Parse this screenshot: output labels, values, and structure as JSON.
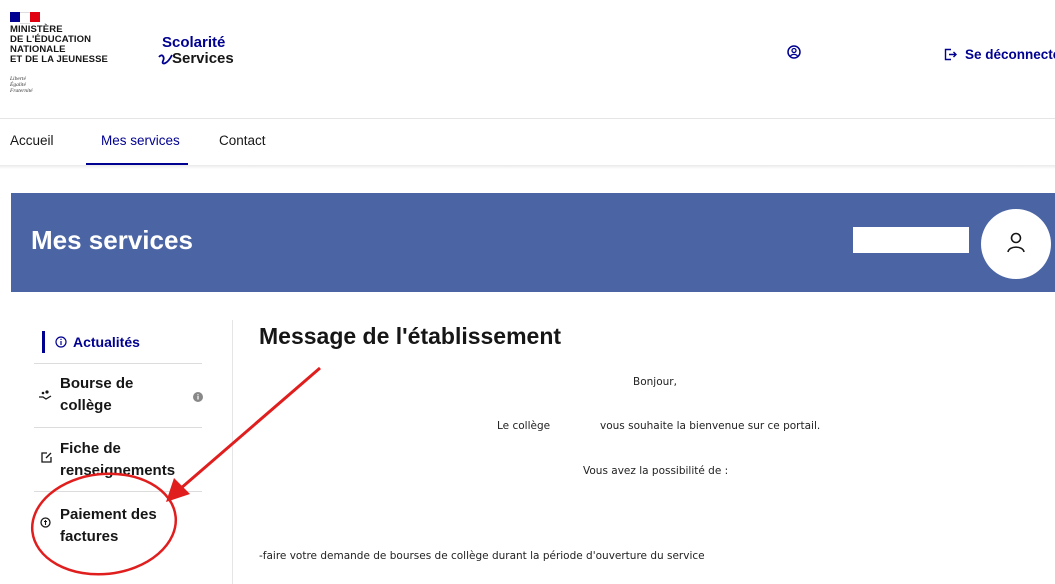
{
  "header": {
    "ministry_name": "MINISTÈRE\nDE L'ÉDUCATION\nNATIONALE\nET DE LA JEUNESSE",
    "motto": "Liberté\nÉgalité\nFraternité",
    "brand_top": "Scolarité",
    "brand_bottom": "Services",
    "logout_label": "Se déconnecter",
    "icons": [
      "account-icon",
      "logout-icon"
    ],
    "flag_colors": [
      "#000091",
      "#ffffff",
      "#e1000f"
    ]
  },
  "nav": {
    "items": [
      {
        "label": "Accueil",
        "active": false
      },
      {
        "label": "Mes services",
        "active": true
      },
      {
        "label": "Contact",
        "active": false
      }
    ]
  },
  "banner": {
    "title": "Mes services",
    "color": "#4a64a4"
  },
  "sidebar": {
    "items": [
      {
        "label": "Actualités",
        "icon": "info-icon",
        "active": true
      },
      {
        "label": "Bourse de collège",
        "icon": "hand-coins-icon",
        "badge_icon": "info-badge-icon"
      },
      {
        "label": "Fiche de renseignements",
        "icon": "edit-icon"
      },
      {
        "label": "Paiement des factures",
        "icon": "payment-icon"
      }
    ]
  },
  "main": {
    "title": "Message de l'établissement",
    "lines": [
      "Bonjour,",
      "Le collège",
      "vous souhaite la bienvenue sur ce portail.",
      "Vous avez la possibilité de  :",
      "-faire votre demande de bourses de collège durant la période d'ouverture du service"
    ]
  },
  "annotation": {
    "color": "#e01e1e"
  }
}
